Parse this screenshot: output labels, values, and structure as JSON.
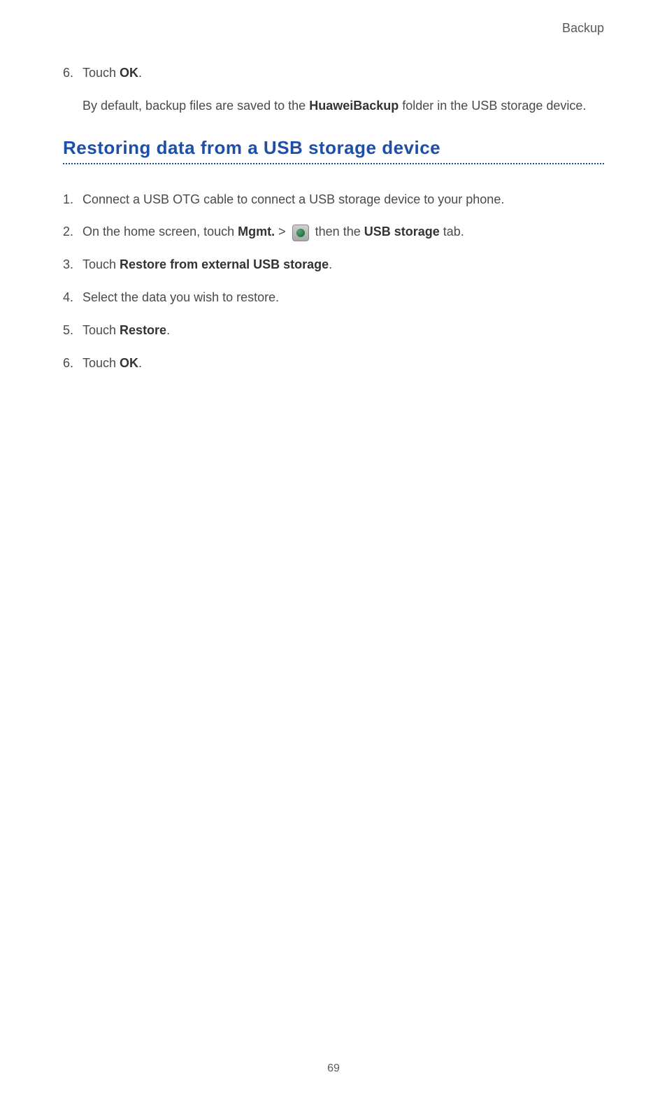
{
  "header": {
    "title": "Backup"
  },
  "prior_steps": {
    "step6": {
      "num": "6.",
      "prefix": "Touch ",
      "bold": "OK",
      "suffix": "."
    },
    "note": {
      "part1": "By default, backup files are saved to the ",
      "bold": "HuaweiBackup",
      "part2": " folder in the USB storage device."
    }
  },
  "section": {
    "heading": "Restoring data from a USB storage device",
    "steps": {
      "s1": {
        "num": "1.",
        "text": "Connect a USB OTG cable to connect a USB storage device to your phone."
      },
      "s2": {
        "num": "2.",
        "prefix": "On the home screen, touch ",
        "bold1": "Mgmt.",
        "mid1": " > ",
        "mid2": " then the ",
        "bold2": "USB storage",
        "suffix": " tab."
      },
      "s3": {
        "num": "3.",
        "prefix": "Touch ",
        "bold": "Restore from external USB storage",
        "suffix": "."
      },
      "s4": {
        "num": "4.",
        "text": "Select the data you wish to restore."
      },
      "s5": {
        "num": "5.",
        "prefix": "Touch ",
        "bold": "Restore",
        "suffix": "."
      },
      "s6": {
        "num": "6.",
        "prefix": "Touch ",
        "bold": "OK",
        "suffix": "."
      }
    }
  },
  "page_number": "69"
}
